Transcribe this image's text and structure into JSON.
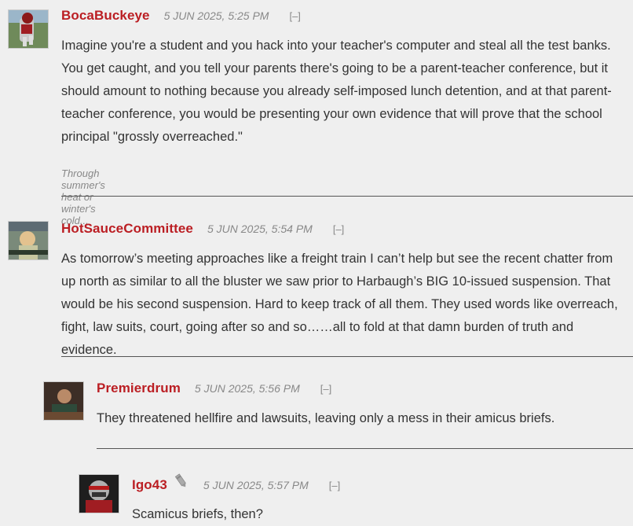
{
  "comments": [
    {
      "author": "BocaBuckeye",
      "date": "5 JUN 2025, 5:25 PM",
      "collapse": "[–]",
      "body": "Imagine you're a student and you hack into your teacher's computer and steal all the test banks. You get caught, and you tell your parents there's going to be a parent-teacher conference, but it should amount to nothing because you already self-imposed lunch detention, and at that parent-teacher conference, you would be presenting your own evidence that will prove that the school principal \"grossly overreached.\"",
      "signature": "Through summer's heat or winter's cold..."
    },
    {
      "author": "HotSauceCommittee",
      "date": "5 JUN 2025, 5:54 PM",
      "collapse": "[–]",
      "body": "As tomorrow’s meeting approaches like a freight train I can’t help but see the recent chatter from up north as similar to all the bluster we saw prior to Harbaugh’s BIG 10-issued suspension. That would be his second suspension. Hard to keep track of all them. They used words like overreach, fight, law suits, court, going after so and so……all to fold at that damn burden of truth and evidence."
    },
    {
      "author": "Premierdrum",
      "date": "5 JUN 2025, 5:56 PM",
      "collapse": "[–]",
      "body": "They threatened hellfire and lawsuits, leaving only a mess in their amicus briefs."
    },
    {
      "author": "Igo43",
      "date": "5 JUN 2025, 5:57 PM",
      "collapse": "[–]",
      "badge_icon": "pencil-icon",
      "body": "Scamicus briefs, then?"
    }
  ],
  "colors": {
    "author": "#bb1e23",
    "background": "#efefef",
    "text": "#333333",
    "meta": "#888888"
  }
}
